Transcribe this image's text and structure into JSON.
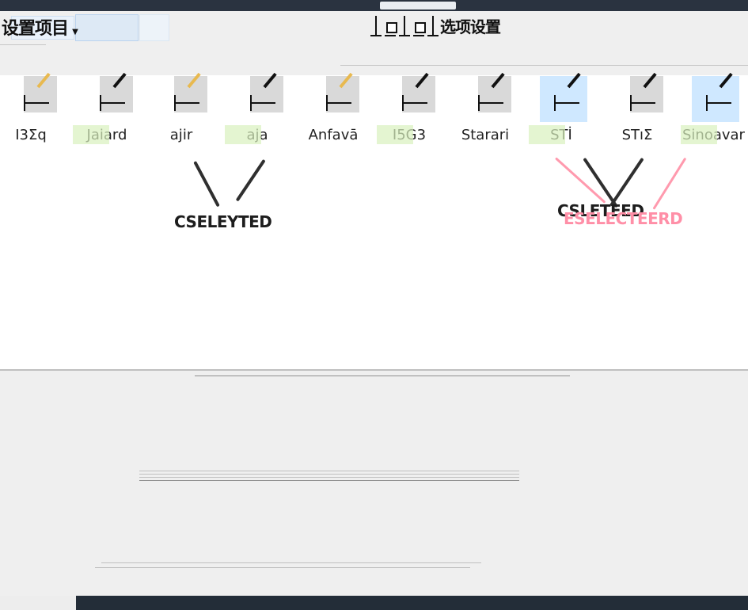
{
  "window": {
    "top_tab": "",
    "toolbar_left_text": "设置项目",
    "toolbar_right_text": "选项设置"
  },
  "files": [
    {
      "label": "I3Σq",
      "selected": false,
      "brush_gold": true
    },
    {
      "label": "Jaiard",
      "selected": false,
      "brush_gold": false
    },
    {
      "label": "ajir",
      "selected": false,
      "brush_gold": true
    },
    {
      "label": "aja",
      "selected": false,
      "brush_gold": false
    },
    {
      "label": "Anfavā",
      "selected": false,
      "brush_gold": true
    },
    {
      "label": "I5G3",
      "selected": false,
      "brush_gold": false
    },
    {
      "label": "Starari",
      "selected": false,
      "brush_gold": false
    },
    {
      "label": "STİ",
      "selected": true,
      "brush_gold": false
    },
    {
      "label": "STıΣ",
      "selected": false,
      "brush_gold": false
    },
    {
      "label": "Sinoavar",
      "selected": true,
      "brush_gold": false
    }
  ],
  "annotations": {
    "left_callout": "CSELEYTED",
    "right_callout_dark": "CSLETEED",
    "right_callout_red": "ESELECTEERD"
  },
  "colors": {
    "titlebar": "#2a3340",
    "selection": "#cfe8ff",
    "tag_green": "#d8f1be",
    "callout_red": "#ff8fa7"
  }
}
